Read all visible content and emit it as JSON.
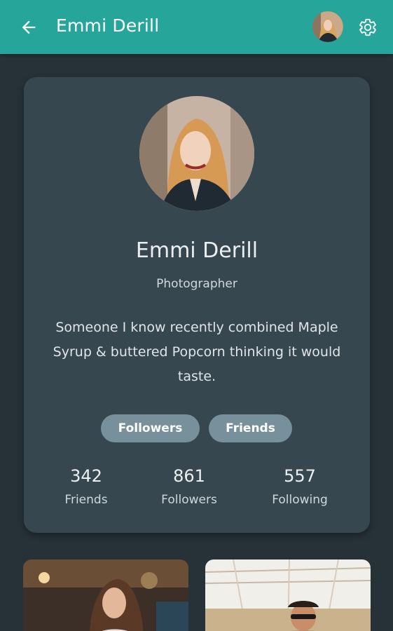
{
  "appbar": {
    "title": "Emmi Derill",
    "back_icon": "arrow-left-icon",
    "settings_icon": "gear-icon",
    "color": "#26a69a"
  },
  "profile": {
    "name": "Emmi Derill",
    "role": "Photographer",
    "bio": "Someone I know recently combined Maple Syrup & buttered Popcorn thinking it would taste.",
    "buttons": {
      "followers": "Followers",
      "friends": "Friends"
    },
    "stats": [
      {
        "value": "342",
        "label": "Friends"
      },
      {
        "value": "861",
        "label": "Followers"
      },
      {
        "value": "557",
        "label": "Following"
      }
    ]
  },
  "colors": {
    "background": "#263238",
    "card": "#37474f",
    "chip": "#78909c"
  }
}
